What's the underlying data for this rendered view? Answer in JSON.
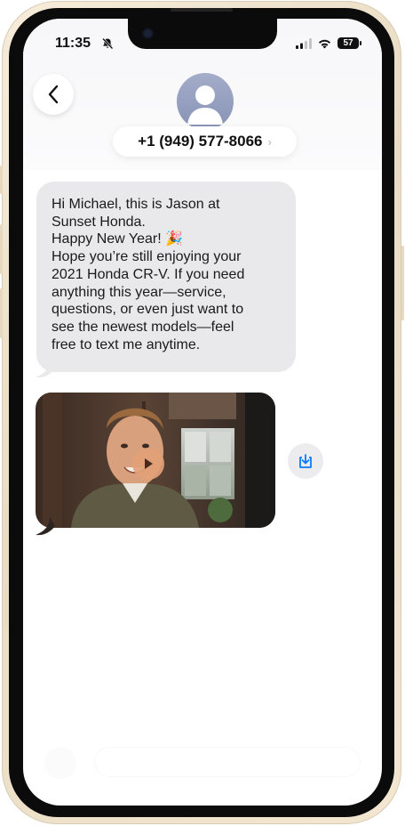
{
  "status_bar": {
    "time": "11:35",
    "battery": "57",
    "icons": [
      "bell-slash-icon",
      "cellular-signal-icon",
      "wifi-icon",
      "battery-icon"
    ]
  },
  "header": {
    "back_icon": "chevron-left-icon",
    "avatar_icon": "person-silhouette-icon",
    "contact_number": "+1 (949) 577-8066",
    "chevron": "›"
  },
  "messages": [
    {
      "direction": "incoming",
      "type": "text",
      "text": "Hi Michael, this is Jason at\nSunset Honda.\nHappy New Year! 🎉\nHope you’re still enjoying your\n2021 Honda CR-V. If you need\nanything this year—service,\nquestions, or even just want to\nsee the newest models—feel\nfree to text me anytime."
    },
    {
      "direction": "incoming",
      "type": "video",
      "play_icon": "play-icon",
      "save_icon": "download-icon"
    }
  ],
  "colors": {
    "incoming_bubble": "#e9e9eb",
    "accent": "#0a7aff",
    "frame": "#efe3cd"
  }
}
